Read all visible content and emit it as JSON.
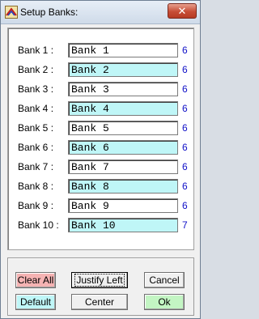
{
  "window": {
    "title": "Setup Banks:",
    "close_glyph": "✕"
  },
  "colors": {
    "even_field_bg": "#bff6f7",
    "odd_field_bg": "#ffffff",
    "count_color": "#1010c8",
    "clear_all_bg": "#f5b3b3",
    "default_bg": "#bff6f7",
    "ok_bg": "#c3f5c3"
  },
  "banks": [
    {
      "label": "Bank 1 :",
      "value": "Bank 1",
      "count": "6"
    },
    {
      "label": "Bank 2 :",
      "value": "Bank 2",
      "count": "6"
    },
    {
      "label": "Bank 3 :",
      "value": "Bank 3",
      "count": "6"
    },
    {
      "label": "Bank 4 :",
      "value": "Bank 4",
      "count": "6"
    },
    {
      "label": "Bank 5 :",
      "value": "Bank 5",
      "count": "6"
    },
    {
      "label": "Bank 6 :",
      "value": "Bank 6",
      "count": "6"
    },
    {
      "label": "Bank 7 :",
      "value": "Bank 7",
      "count": "6"
    },
    {
      "label": "Bank 8 :",
      "value": "Bank 8",
      "count": "6"
    },
    {
      "label": "Bank 9 :",
      "value": "Bank 9",
      "count": "6"
    },
    {
      "label": "Bank 10 :",
      "value": "Bank 10",
      "count": "7"
    }
  ],
  "buttons": {
    "clear_all": "Clear All",
    "justify_left": "Justify Left",
    "cancel": "Cancel",
    "default": "Default",
    "center": "Center",
    "ok": "Ok"
  }
}
